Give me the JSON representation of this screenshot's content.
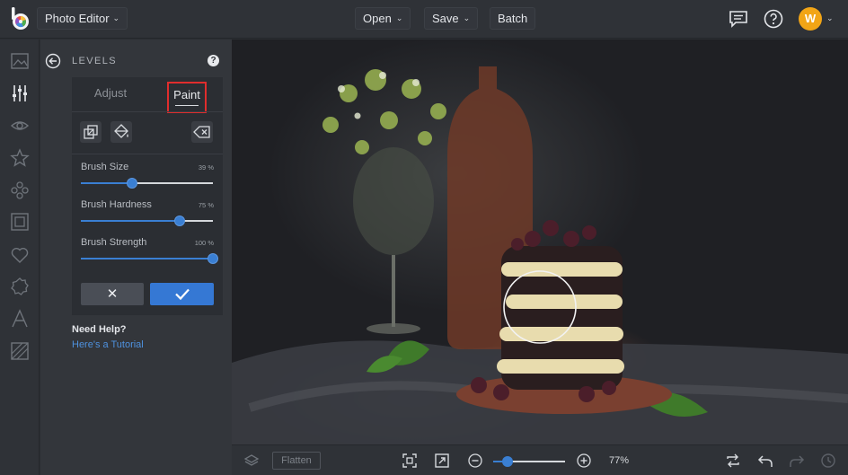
{
  "topbar": {
    "app_title": "Photo Editor",
    "open_label": "Open",
    "save_label": "Save",
    "batch_label": "Batch",
    "user_initial": "W"
  },
  "panel": {
    "title": "LEVELS",
    "help_glyph": "?",
    "tabs": {
      "adjust": "Adjust",
      "paint": "Paint"
    },
    "active_tab": "Paint",
    "sliders": [
      {
        "label": "Brush Size",
        "value": "39 %",
        "fraction": 0.39
      },
      {
        "label": "Brush Hardness",
        "value": "75 %",
        "fraction": 0.75
      },
      {
        "label": "Brush Strength",
        "value": "100 %",
        "fraction": 1.0
      }
    ],
    "cancel_glyph": "✕",
    "need_help": "Need Help?",
    "tutorial_link": "Here's a Tutorial"
  },
  "bottombar": {
    "flatten_label": "Flatten",
    "zoom_value": "77%",
    "zoom_fraction": 0.2
  },
  "colors": {
    "accent": "#3578d4",
    "avatar": "#f2a516",
    "highlight_box": "#e02d2d"
  }
}
